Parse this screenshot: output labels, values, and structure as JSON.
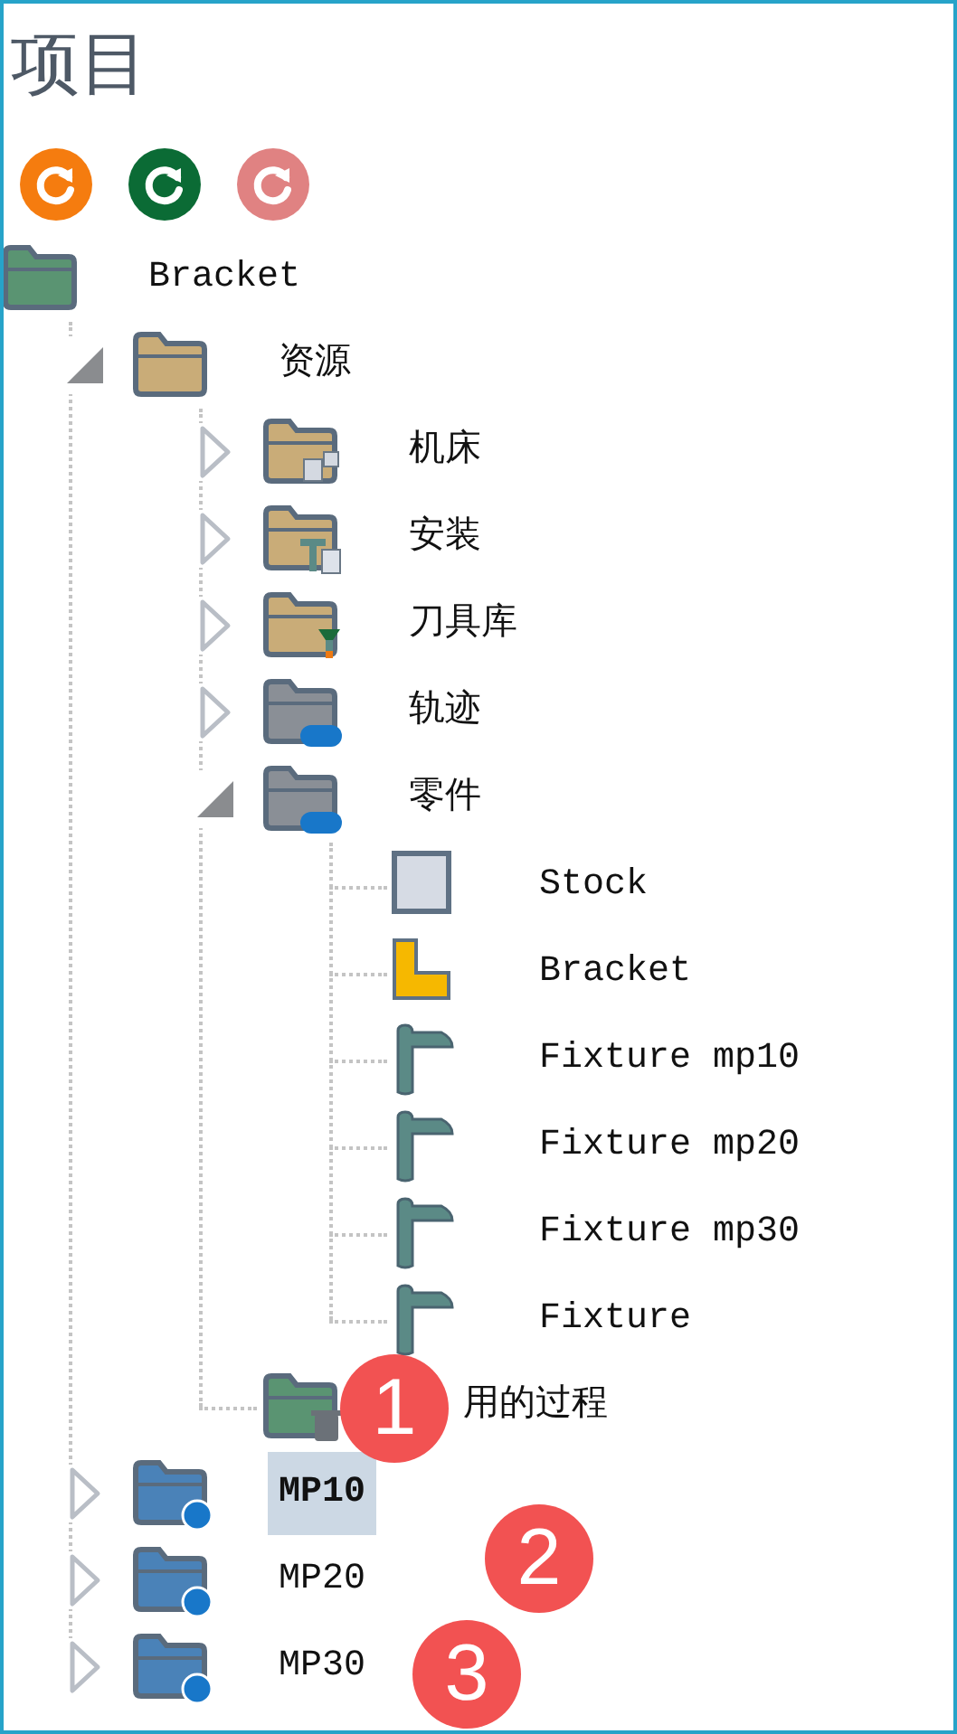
{
  "panel": {
    "title": "项目"
  },
  "toolbar": [
    {
      "kind": "refresh",
      "color": "#f57c0f"
    },
    {
      "kind": "refresh",
      "color": "#0b6b35"
    },
    {
      "kind": "refresh",
      "color": "#e08282"
    }
  ],
  "tree": [
    {
      "label": "Bracket",
      "kind": "project",
      "selected": false,
      "children": [
        {
          "label": "资源",
          "kind": "folder",
          "selected": false,
          "expanded": true,
          "children": [
            {
              "label": "机床",
              "kind": "machine",
              "selected": false,
              "expanded": false
            },
            {
              "label": "安装",
              "kind": "setup",
              "selected": false,
              "expanded": false
            },
            {
              "label": "刀具库",
              "kind": "tools",
              "selected": false,
              "expanded": false
            },
            {
              "label": "轨迹",
              "kind": "toolpath",
              "selected": false,
              "expanded": false
            },
            {
              "label": "零件",
              "kind": "cad",
              "selected": false,
              "expanded": true,
              "children": [
                {
                  "label": "Stock",
                  "kind": "stock",
                  "selected": false
                },
                {
                  "label": "Bracket",
                  "kind": "part",
                  "selected": false
                },
                {
                  "label": "Fixture mp10",
                  "kind": "fixture",
                  "selected": false
                },
                {
                  "label": "Fixture mp20",
                  "kind": "fixture",
                  "selected": false
                },
                {
                  "label": "Fixture mp30",
                  "kind": "fixture",
                  "selected": false
                },
                {
                  "label": "Fixture",
                  "kind": "fixture",
                  "selected": false
                }
              ]
            },
            {
              "label": "用的过程",
              "kind": "unused",
              "selected": false
            }
          ]
        },
        {
          "label": "MP10",
          "kind": "operation",
          "selected": true,
          "expanded": false
        },
        {
          "label": "MP20",
          "kind": "operation",
          "selected": false,
          "expanded": false
        },
        {
          "label": "MP30",
          "kind": "operation",
          "selected": false,
          "expanded": false
        }
      ]
    }
  ],
  "callouts": [
    "1",
    "2",
    "3"
  ]
}
